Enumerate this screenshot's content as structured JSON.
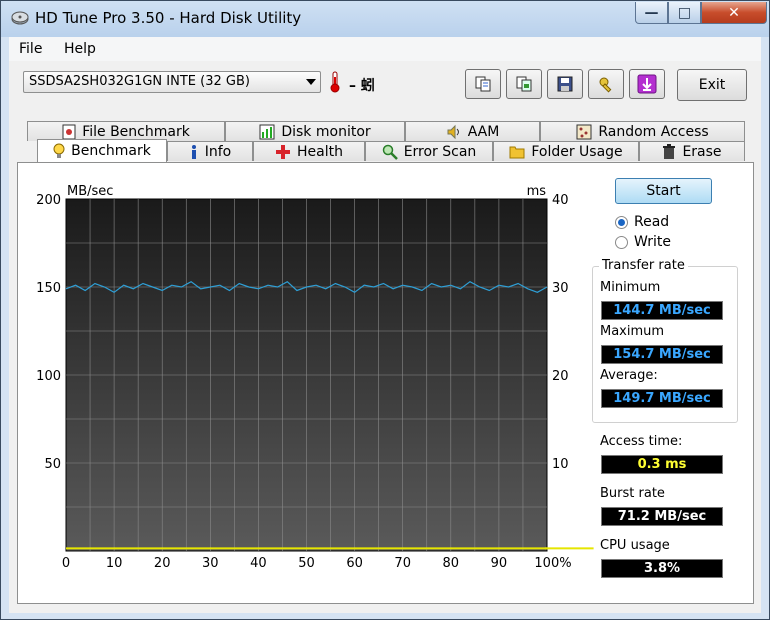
{
  "window": {
    "title": "HD Tune Pro 3.50 - Hard Disk Utility",
    "min_symbol": "—",
    "max_symbol": "□",
    "close_symbol": "✕"
  },
  "menu": {
    "file": "File",
    "help": "Help"
  },
  "toolbar": {
    "drive": "SSDSA2SH032G1GN INTE (32 GB)",
    "temperature": "– 蚓",
    "exit": "Exit"
  },
  "tabs_top": [
    "File Benchmark",
    "Disk monitor",
    "AAM",
    "Random Access"
  ],
  "tabs_bottom": [
    "Benchmark",
    "Info",
    "Health",
    "Error Scan",
    "Folder Usage",
    "Erase"
  ],
  "controls": {
    "start": "Start",
    "read": "Read",
    "write": "Write",
    "selected_mode": "Read"
  },
  "results": {
    "transfer_rate_title": "Transfer rate",
    "minimum_label": "Minimum",
    "minimum_value": "144.7 MB/sec",
    "maximum_label": "Maximum",
    "maximum_value": "154.7 MB/sec",
    "average_label": "Average:",
    "average_value": "149.7 MB/sec",
    "access_label": "Access time:",
    "access_value": "0.3 ms",
    "burst_label": "Burst rate",
    "burst_value": "71.2 MB/sec",
    "cpu_label": "CPU usage",
    "cpu_value": "3.8%"
  },
  "colors": {
    "read_line": "#2e9fd6",
    "access_points": "#e6e600",
    "value_blue": "#3aa7ff",
    "value_yellow": "#ffff33",
    "value_white": "#ffffff"
  },
  "chart_data": {
    "type": "line",
    "ylabel_left": "MB/sec",
    "ylabel_right": "ms",
    "ylim_left": [
      0,
      200
    ],
    "ylim_right": [
      0,
      40
    ],
    "yticks_left": [
      "200",
      "150",
      "100",
      "50"
    ],
    "yticks_right": [
      "40",
      "30",
      "20",
      "10"
    ],
    "xticks": [
      "0",
      "10",
      "20",
      "30",
      "40",
      "50",
      "60",
      "70",
      "80",
      "90",
      "100%"
    ],
    "series": [
      {
        "name": "Transfer rate",
        "x": [
          0,
          2,
          4,
          6,
          8,
          10,
          12,
          14,
          16,
          18,
          20,
          22,
          24,
          26,
          28,
          30,
          32,
          34,
          36,
          38,
          40,
          42,
          44,
          46,
          48,
          50,
          52,
          54,
          56,
          58,
          60,
          62,
          64,
          66,
          68,
          70,
          72,
          74,
          76,
          78,
          80,
          82,
          84,
          86,
          88,
          90,
          92,
          94,
          96,
          98,
          100
        ],
        "values": [
          149,
          151,
          148,
          152,
          150,
          147,
          151,
          149,
          152,
          150,
          148,
          151,
          150,
          153,
          149,
          150,
          151,
          148,
          152,
          150,
          149,
          151,
          150,
          153,
          148,
          150,
          151,
          149,
          152,
          150,
          147,
          151,
          150,
          152,
          149,
          151,
          150,
          148,
          152,
          150,
          151,
          149,
          153,
          150,
          148,
          151,
          150,
          152,
          149,
          147,
          150
        ]
      },
      {
        "name": "Access time",
        "x": [
          0,
          10,
          20,
          30,
          40,
          50,
          60,
          70,
          80,
          90,
          100
        ],
        "values": [
          0.3,
          0.3,
          0.3,
          0.3,
          0.3,
          0.3,
          0.3,
          0.3,
          0.3,
          0.3,
          0.3
        ]
      }
    ],
    "grid": true
  }
}
